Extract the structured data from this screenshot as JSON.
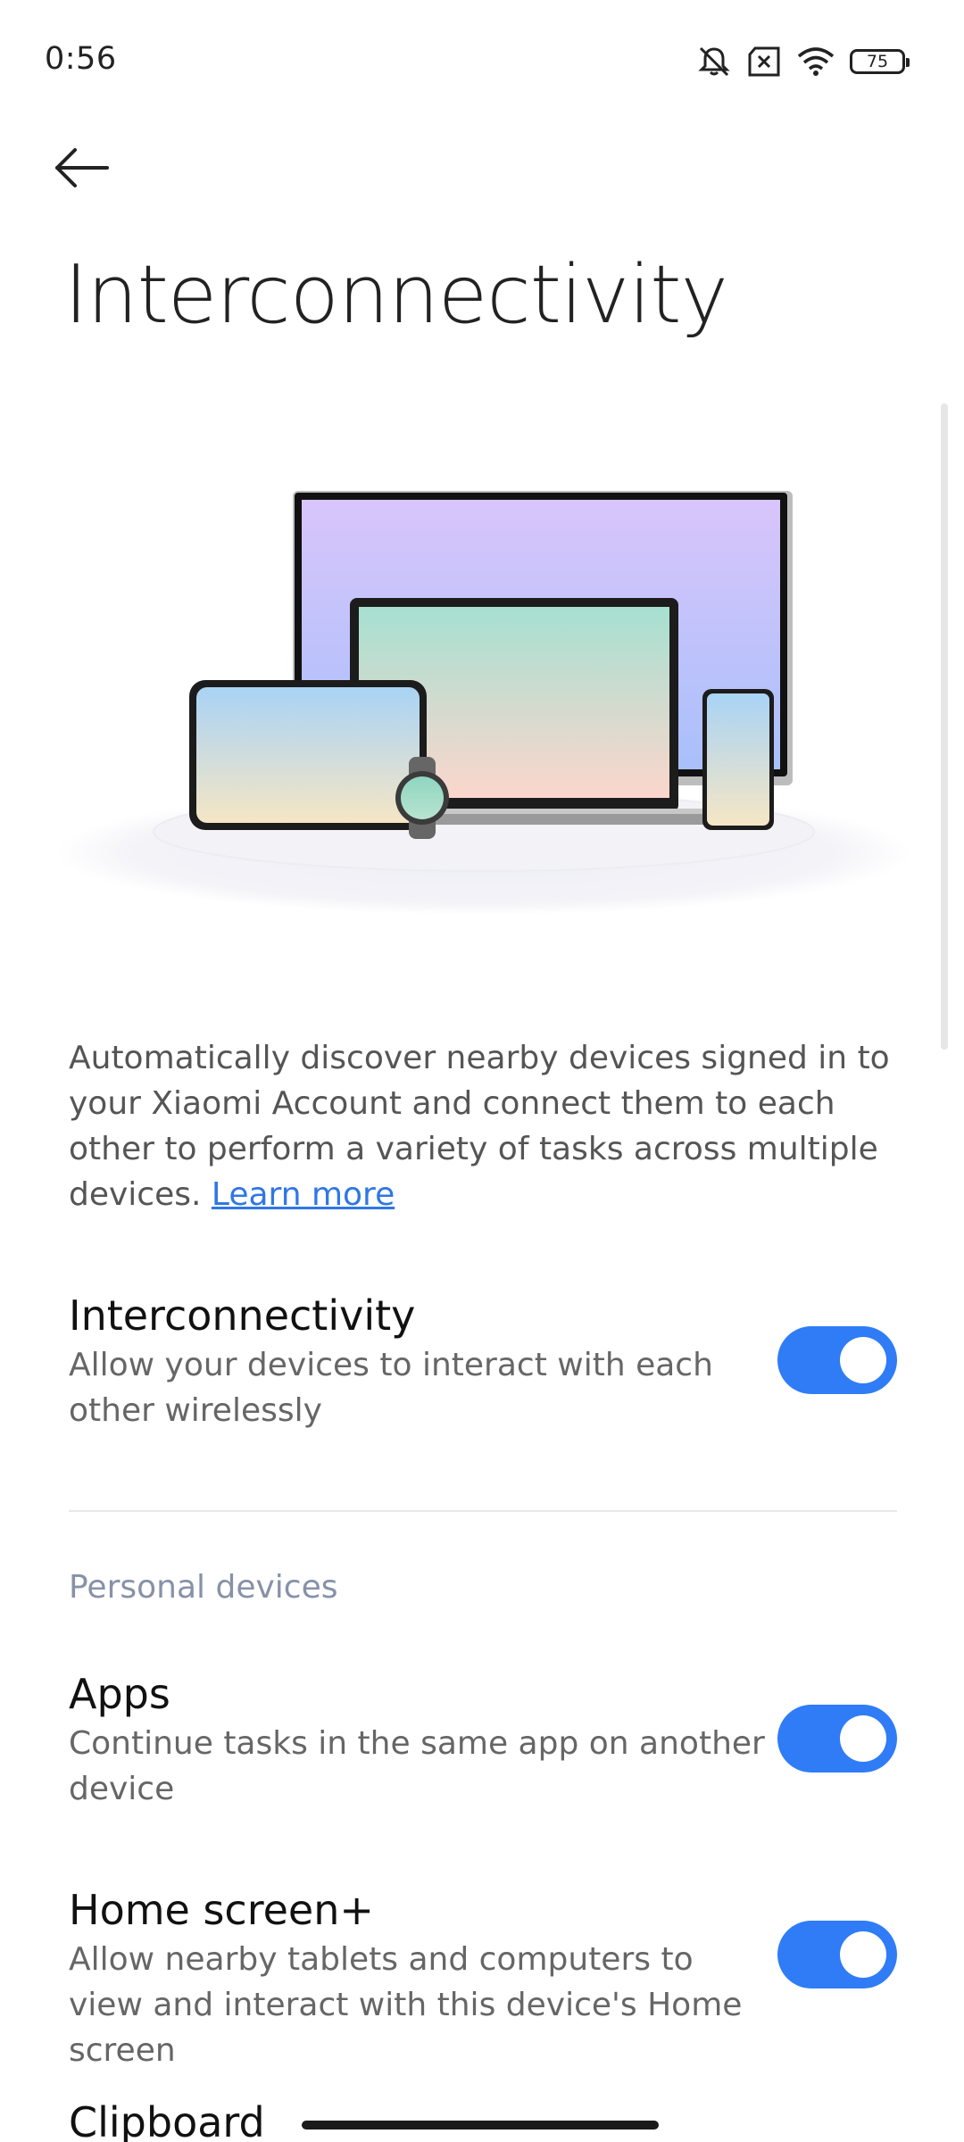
{
  "status_bar": {
    "time": "0:56",
    "battery_level": "75",
    "icons": [
      "mute-icon",
      "no-sim-icon",
      "wifi-icon",
      "battery-icon"
    ]
  },
  "header": {
    "back_icon": "arrow-left-icon",
    "title": "Interconnectivity"
  },
  "intro": {
    "description": "Automatically discover nearby devices signed in to your Xiaomi Account and connect them to each other to perform a variety of tasks across multiple devices.",
    "learn_more": "Learn more"
  },
  "main_setting": {
    "title": "Interconnectivity",
    "description": "Allow your devices to interact with each other wirelessly",
    "enabled": true
  },
  "personal_devices": {
    "header": "Personal devices",
    "items": [
      {
        "title": "Apps",
        "description": "Continue tasks in the same app on another device",
        "enabled": true
      },
      {
        "title": "Home screen+",
        "description": "Allow nearby tablets and computers to view and interact with this device's Home screen",
        "enabled": true
      },
      {
        "title": "Clipboard"
      }
    ]
  },
  "colors": {
    "accent": "#2f7cf6",
    "link": "#2f77e6",
    "section_header": "#8791a8"
  }
}
